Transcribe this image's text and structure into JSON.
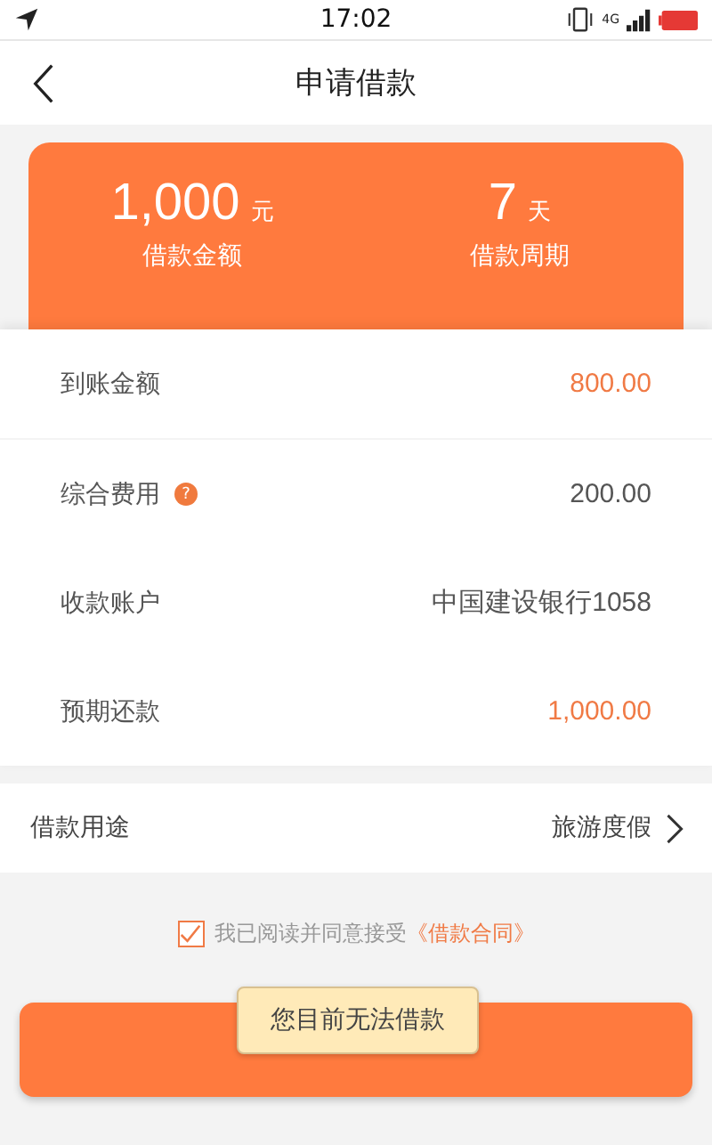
{
  "status_bar": {
    "time": "17:02",
    "network": "4G"
  },
  "header": {
    "title": "申请借款"
  },
  "summary": [
    {
      "value": "1,000",
      "unit": "元",
      "label": "借款金额"
    },
    {
      "value": "7",
      "unit": "天",
      "label": "借款周期"
    }
  ],
  "details": [
    {
      "label": "到账金额",
      "value": "800.00",
      "highlight": true
    },
    {
      "label": "综合费用",
      "value": "200.00",
      "highlight": false,
      "help": "?"
    },
    {
      "label": "收款账户",
      "value": "中国建设银行1058",
      "highlight": false
    },
    {
      "label": "预期还款",
      "value": "1,000.00",
      "highlight": true
    }
  ],
  "purpose": {
    "label": "借款用途",
    "value": "旅游度假"
  },
  "agreement": {
    "checked": true,
    "text": "我已阅读并同意接受",
    "link": "《借款合同》"
  },
  "toast": "您目前无法借款"
}
